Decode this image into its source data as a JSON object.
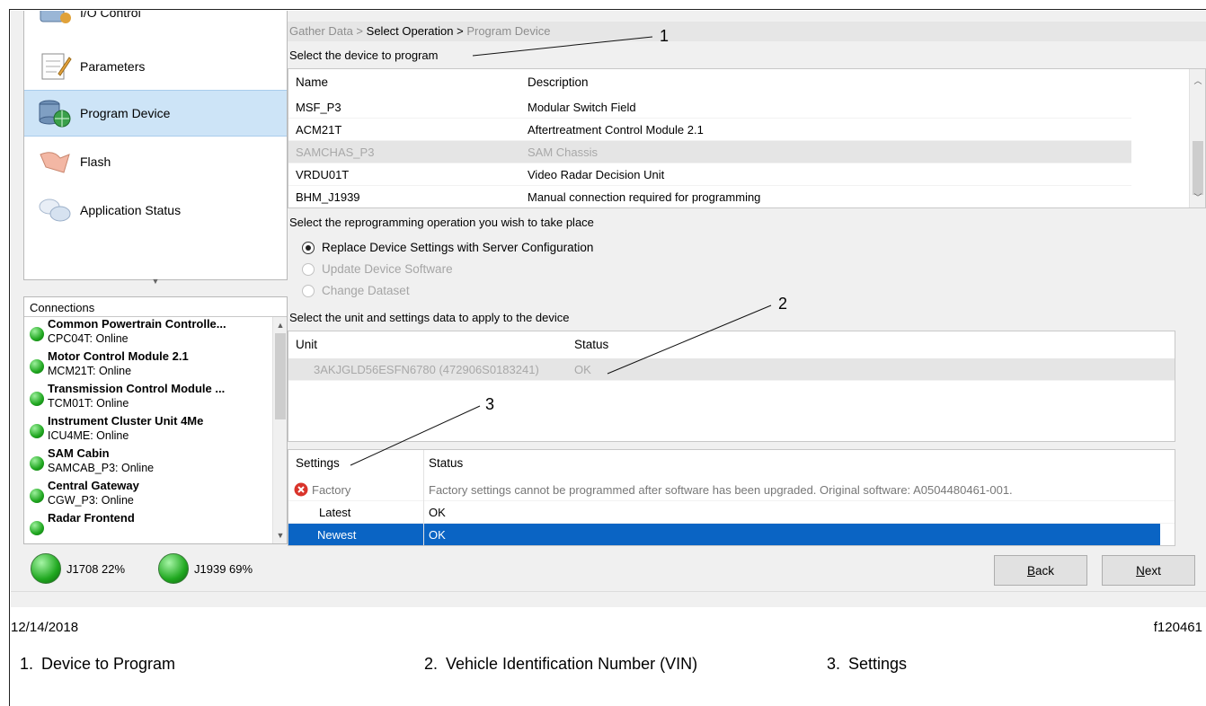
{
  "nav": {
    "items": [
      {
        "label": "I/O Control",
        "icon": "io-control-icon"
      },
      {
        "label": "Parameters",
        "icon": "notepad-icon"
      },
      {
        "label": "Program Device",
        "icon": "database-globe-icon",
        "selected": true
      },
      {
        "label": "Flash",
        "icon": "flash-icon"
      },
      {
        "label": "Application Status",
        "icon": "chat-bubbles-icon"
      }
    ]
  },
  "connections": {
    "title": "Connections",
    "items": [
      {
        "name": "Common Powertrain Controlle...",
        "status": "CPC04T: Online"
      },
      {
        "name": "Motor Control Module 2.1",
        "status": "MCM21T: Online"
      },
      {
        "name": "Transmission Control Module ...",
        "status": "TCM01T: Online"
      },
      {
        "name": "Instrument Cluster Unit 4Me",
        "status": "ICU4ME: Online"
      },
      {
        "name": "SAM Cabin",
        "status": "SAMCAB_P3: Online"
      },
      {
        "name": "Central Gateway",
        "status": "CGW_P3: Online"
      },
      {
        "name": "Radar Frontend",
        "status": ""
      }
    ]
  },
  "status_leds": [
    {
      "label": "J1708 22%"
    },
    {
      "label": "J1939 69%"
    }
  ],
  "breadcrumb": {
    "step1": "Gather Data >",
    "step2": "Select Operation >",
    "step3": "Program Device"
  },
  "device_section": {
    "label": "Select the device to program",
    "col_name": "Name",
    "col_desc": "Description",
    "rows": [
      {
        "name": "MSF_P3",
        "desc": "Modular Switch Field"
      },
      {
        "name": "ACM21T",
        "desc": "Aftertreatment Control Module 2.1"
      },
      {
        "name": "SAMCHAS_P3",
        "desc": "SAM Chassis",
        "disabled": true
      },
      {
        "name": "VRDU01T",
        "desc": "Video Radar Decision Unit"
      },
      {
        "name": "BHM_J1939",
        "desc": "Manual connection required for programming"
      }
    ]
  },
  "operation_section": {
    "label": "Select the reprogramming operation you wish to take place",
    "options": [
      {
        "label": "Replace Device Settings with Server Configuration",
        "selected": true
      },
      {
        "label": "Update Device Software",
        "disabled": true
      },
      {
        "label": "Change Dataset",
        "disabled": true
      }
    ]
  },
  "unit_section": {
    "label": "Select the unit and settings data to apply to the device",
    "col_unit": "Unit",
    "col_status": "Status",
    "rows": [
      {
        "unit": "3AKJGLD56ESFN6780 (472906S0183241)",
        "status": "OK"
      }
    ]
  },
  "settings_section": {
    "col_settings": "Settings",
    "col_status": "Status",
    "rows": [
      {
        "setting": "Factory",
        "status": "Factory settings cannot be programmed after software has been upgraded. Original software: A0504480461-001.",
        "error": true
      },
      {
        "setting": "Latest",
        "status": "OK"
      },
      {
        "setting": "Newest",
        "status": "OK",
        "selected": true
      }
    ]
  },
  "buttons": {
    "back_pre": "",
    "back_ul": "B",
    "back_post": "ack",
    "next_pre": "",
    "next_ul": "N",
    "next_post": "ext"
  },
  "footer": {
    "date": "12/14/2018",
    "figure_id": "f120461"
  },
  "callouts": [
    "1",
    "2",
    "3"
  ],
  "legend": [
    {
      "num": "1.",
      "text": "Device to Program"
    },
    {
      "num": "2.",
      "text": "Vehicle Identification Number (VIN)"
    },
    {
      "num": "3.",
      "text": "Settings"
    }
  ]
}
